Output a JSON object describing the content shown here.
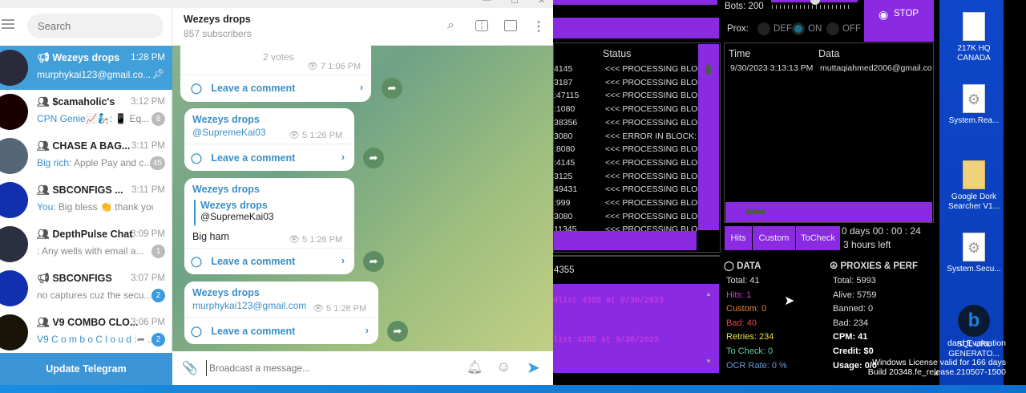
{
  "telegram": {
    "search_placeholder": "Search",
    "update_label": "Update Telegram",
    "chats": [
      {
        "name": "Wezeys drops",
        "kind": "channel",
        "time": "1:28 PM",
        "preview": "murphykai123@gmail.co...",
        "who": "",
        "badge": "",
        "pinned": true,
        "active": true,
        "avatar_color": "#2a2a3a"
      },
      {
        "name": "$camaholic's",
        "kind": "group",
        "time": "3:12 PM",
        "who": "CPN Genie📈🧞:",
        "preview": " 📱 Eq...",
        "badge": "8",
        "blue": false,
        "avatar_color": "#1a0000"
      },
      {
        "name": "CHASE A BAG...",
        "kind": "group",
        "time": "3:11 PM",
        "who": "Big rich:",
        "preview": " Apple Pay and c...",
        "badge": "45",
        "blue": false,
        "avatar_color": "#556677"
      },
      {
        "name": "SBCONFIGS ...",
        "kind": "group",
        "time": "3:11 PM",
        "who": "You:",
        "preview": " Big bless 👏 thank you fr",
        "badge": "",
        "blue": false,
        "avatar_color": "#1030b0"
      },
      {
        "name": "DepthPulse Chat",
        "kind": "group",
        "time": "3:09 PM",
        "who": "",
        "preview": ": Any wells with email a...",
        "badge": "1",
        "blue": false,
        "avatar_color": "#2a3040"
      },
      {
        "name": "SBCONFIGS",
        "kind": "channel",
        "time": "3:07 PM",
        "who": "",
        "preview": "no captures cuz the secu...",
        "badge": "2",
        "blue": true,
        "avatar_color": "#1030b0"
      },
      {
        "name": "V9 COMBO CLO...",
        "kind": "group",
        "time": "3:06 PM",
        "who": "V9 C o m b o C l o u d :",
        "preview": "➦ ...",
        "badge": "2",
        "blue": true,
        "avatar_color": "#1a1408"
      }
    ],
    "header": {
      "title": "Wezeys drops",
      "subtitle": "857 subscribers"
    },
    "messages": [
      {
        "votes": "2 votes",
        "views": "7",
        "time": "1:06 PM",
        "comment": "Leave a comment"
      },
      {
        "name": "Wezeys drops",
        "text": "@SupremeKai03",
        "views": "5",
        "time": "1:26 PM",
        "comment": "Leave a comment"
      },
      {
        "name": "Wezeys drops",
        "reply_name": "Wezeys drops",
        "reply_text": "@SupremeKai03",
        "text": "Big ham",
        "views": "5",
        "time": "1:26 PM",
        "comment": "Leave a comment"
      },
      {
        "name": "Wezeys drops",
        "text": "murphykai123@gmail.com",
        "views": "5",
        "time": "1:28 PM",
        "comment": "Leave a comment"
      }
    ],
    "composer_placeholder": "Broadcast a message..."
  },
  "checker": {
    "bots_label": "Bots:",
    "bots_value": "200",
    "slider_fraction": 0.45,
    "prox_label": "Prox:",
    "prox_options": [
      "DEF",
      "ON",
      "OFF"
    ],
    "prox_selected": "ON",
    "stop_label": "STOP",
    "log_header": "Status",
    "log_rows": [
      [
        "4145",
        "<<< PROCESSING BLOCK"
      ],
      [
        "3187",
        "<<< PROCESSING BLOCK"
      ],
      [
        ":47115",
        "<<< PROCESSING BLOCK"
      ],
      [
        ":1080",
        "<<< PROCESSING BLOCK"
      ],
      [
        "38356",
        "<<< PROCESSING BLOCK"
      ],
      [
        "3080",
        "<<< ERROR IN BLOCK: R"
      ],
      [
        ":8080",
        "<<< PROCESSING BLOCK"
      ],
      [
        ":4145",
        "<<< PROCESSING BLOCK"
      ],
      [
        "3125",
        "<<< PROCESSING BLOCK"
      ],
      [
        "49431",
        "<<< PROCESSING BLOCK"
      ],
      [
        ":999",
        "<<< PROCESSING BLOCK"
      ],
      [
        "3080",
        "<<< PROCESSING BLOCK"
      ],
      [
        "11345",
        "<<< PROCESSING BLOCK"
      ]
    ],
    "hits_headers": [
      "Time",
      "Data"
    ],
    "hits_rows": [
      [
        "9/30/2023 3:13:13 PM",
        "muttaqiahmed2006@gmail.co"
      ]
    ],
    "tabs": [
      "Hits",
      "Custom",
      "ToCheck"
    ],
    "timer": "0  days  00 : 00 : 24",
    "time_left": "3 hours left",
    "wordlist_id": "4355",
    "console_lines": [
      "dlist 4355 at 9/30/2023",
      "list 4355 at 9/30/2023"
    ],
    "data_title": "DATA",
    "data_stats": [
      {
        "label": "Total:",
        "value": "41",
        "color": "#dddddd"
      },
      {
        "label": "Hits:",
        "value": "1",
        "color": "#d63ad6"
      },
      {
        "label": "Custom:",
        "value": "0",
        "color": "#e8823a"
      },
      {
        "label": "Bad:",
        "value": "40",
        "color": "#e84545"
      },
      {
        "label": "Retries:",
        "value": "234",
        "color": "#e8e04a"
      },
      {
        "label": "To Check:",
        "value": "0",
        "color": "#5fd0a0"
      },
      {
        "label": "OCR Rate:",
        "value": "0 %",
        "color": "#6a9ad8"
      }
    ],
    "proxies_title": "PROXIES & PERF",
    "proxy_stats": [
      {
        "label": "Total:",
        "value": "5993",
        "bold": false
      },
      {
        "label": "Alive:",
        "value": "5759",
        "bold": false
      },
      {
        "label": "Banned:",
        "value": "0",
        "bold": false
      },
      {
        "label": "Bad:",
        "value": "234",
        "bold": false
      },
      {
        "label": "CPM:",
        "value": "41",
        "bold": true
      },
      {
        "label": "Credit:",
        "value": "$0",
        "bold": true
      },
      {
        "label": "Usage:",
        "value": "0/0",
        "bold": true
      }
    ]
  },
  "desktop": {
    "icons": [
      {
        "label": "217K HQ CANADA",
        "type": "text-file"
      },
      {
        "label": "System.Rea...",
        "type": "config-file"
      },
      {
        "label": "Google Dork Searcher V1...",
        "type": "folder"
      },
      {
        "label": "System.Secu...",
        "type": "config-file"
      },
      {
        "label": "SQL URL GENERATO...",
        "type": "bing-app"
      }
    ],
    "watermark": [
      "dard Evaluation",
      "Windows License valid for 166 days",
      "Build 20348.fe_release.210507-1500"
    ]
  }
}
